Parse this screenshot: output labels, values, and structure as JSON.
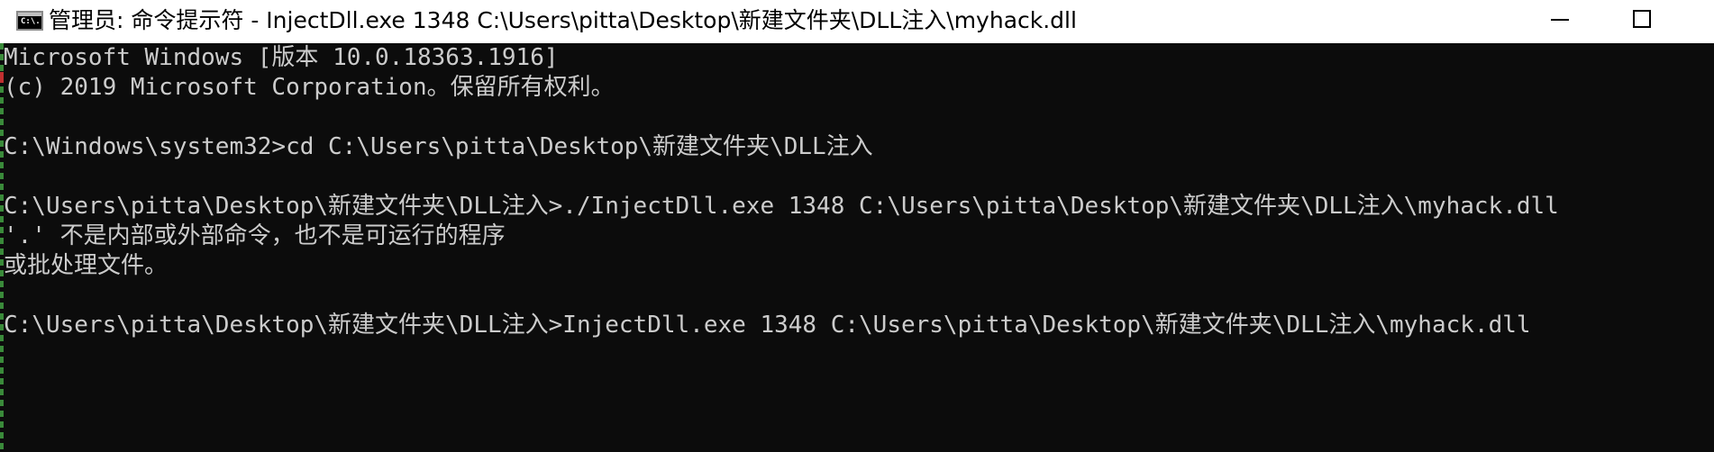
{
  "window": {
    "title": "管理员: 命令提示符 - InjectDll.exe  1348 C:\\Users\\pitta\\Desktop\\新建文件夹\\DLL注入\\myhack.dll",
    "icon": "cmd-icon",
    "icon_text": "C:\\."
  },
  "controls": {
    "minimize": "minimize-icon",
    "maximize": "maximize-icon"
  },
  "console": {
    "lines": [
      "Microsoft Windows [版本 10.0.18363.1916]",
      "(c) 2019 Microsoft Corporation。保留所有权利。",
      "",
      "C:\\Windows\\system32>cd C:\\Users\\pitta\\Desktop\\新建文件夹\\DLL注入",
      "",
      "C:\\Users\\pitta\\Desktop\\新建文件夹\\DLL注入>./InjectDll.exe 1348 C:\\Users\\pitta\\Desktop\\新建文件夹\\DLL注入\\myhack.dll",
      "'.' 不是内部或外部命令，也不是可运行的程序",
      "或批处理文件。",
      "",
      "C:\\Users\\pitta\\Desktop\\新建文件夹\\DLL注入>InjectDll.exe 1348 C:\\Users\\pitta\\Desktop\\新建文件夹\\DLL注入\\myhack.dll"
    ]
  },
  "colors": {
    "background": "#0c0c0c",
    "foreground": "#cccccc",
    "titlebar": "#ffffff"
  }
}
